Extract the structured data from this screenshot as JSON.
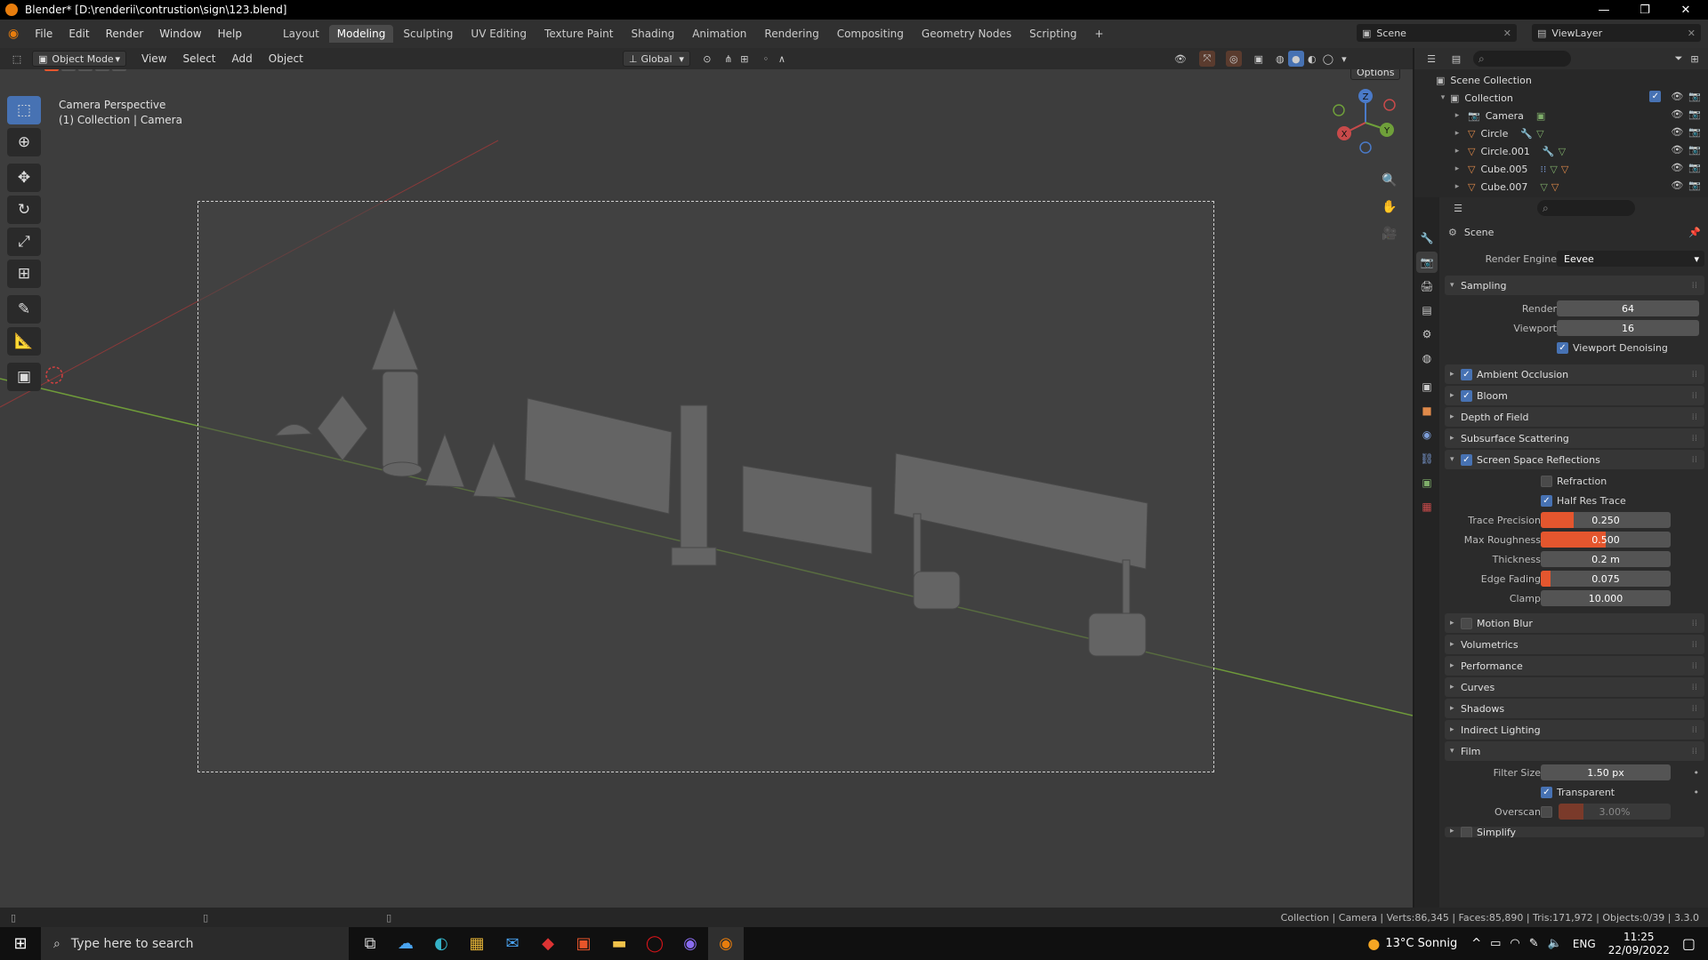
{
  "window": {
    "title": "Blender* [D:\\renderii\\contrustion\\sign\\123.blend]",
    "minimize": "—",
    "restore": "❐",
    "close": "✕"
  },
  "menu": {
    "items": [
      "File",
      "Edit",
      "Render",
      "Window",
      "Help"
    ]
  },
  "workspaces": {
    "tabs": [
      "Layout",
      "Modeling",
      "Sculpting",
      "UV Editing",
      "Texture Paint",
      "Shading",
      "Animation",
      "Rendering",
      "Compositing",
      "Geometry Nodes",
      "Scripting"
    ],
    "active": "Modeling",
    "add": "+"
  },
  "top_right": {
    "scene": "Scene",
    "view_layer": "ViewLayer"
  },
  "viewport_header": {
    "mode": "Object Mode",
    "menus": [
      "View",
      "Select",
      "Add",
      "Object"
    ],
    "orientation": "Global",
    "options": "Options"
  },
  "viewport": {
    "line1": "Camera Perspective",
    "line2": "(1) Collection | Camera"
  },
  "gizmo": {
    "x": "X",
    "y": "Y",
    "z": "Z"
  },
  "outliner": {
    "root": "Scene Collection",
    "collection": "Collection",
    "objects": [
      {
        "name": "Camera",
        "icon": "camera-icon"
      },
      {
        "name": "Circle",
        "icon": "mesh-icon"
      },
      {
        "name": "Circle.001",
        "icon": "mesh-icon"
      },
      {
        "name": "Cube.005",
        "icon": "mesh-icon"
      },
      {
        "name": "Cube.007",
        "icon": "mesh-icon"
      }
    ]
  },
  "properties": {
    "context": "Scene",
    "render_engine_label": "Render Engine",
    "render_engine": "Eevee",
    "sampling": {
      "title": "Sampling",
      "render_label": "Render",
      "render": "64",
      "viewport_label": "Viewport",
      "viewport": "16",
      "denoise": "Viewport Denoising"
    },
    "sections_a": [
      {
        "label": "Ambient Occlusion",
        "checkbox": true,
        "checked": true
      },
      {
        "label": "Bloom",
        "checkbox": true,
        "checked": true
      },
      {
        "label": "Depth of Field",
        "checkbox": false
      },
      {
        "label": "Subsurface Scattering",
        "checkbox": false
      }
    ],
    "ssr": {
      "title": "Screen Space Reflections",
      "refraction": "Refraction",
      "half_res": "Half Res Trace",
      "trace_precision_label": "Trace Precision",
      "trace_precision": "0.250",
      "trace_precision_frac": 0.25,
      "max_roughness_label": "Max Roughness",
      "max_roughness": "0.500",
      "max_roughness_frac": 0.5,
      "thickness_label": "Thickness",
      "thickness": "0.2 m",
      "edge_fading_label": "Edge Fading",
      "edge_fading": "0.075",
      "edge_fading_frac": 0.075,
      "clamp_label": "Clamp",
      "clamp": "10.000"
    },
    "sections_b": [
      {
        "label": "Motion Blur",
        "checkbox": true,
        "checked": false
      },
      {
        "label": "Volumetrics",
        "checkbox": false
      },
      {
        "label": "Performance",
        "checkbox": false
      },
      {
        "label": "Curves",
        "checkbox": false
      },
      {
        "label": "Shadows",
        "checkbox": false
      },
      {
        "label": "Indirect Lighting",
        "checkbox": false
      }
    ],
    "film": {
      "title": "Film",
      "filter_size_label": "Filter Size",
      "filter_size": "1.50 px",
      "transparent": "Transparent",
      "overscan_label": "Overscan",
      "overscan": "3.00%"
    },
    "simplify": "Simplify"
  },
  "status": {
    "text": "Collection | Camera | Verts:86,345 | Faces:85,890 | Tris:171,972 | Objects:0/39 | 3.3.0"
  },
  "taskbar": {
    "search_placeholder": "Type here to search",
    "weather": "13°C  Sonnig",
    "lang": "ENG",
    "time": "11:25",
    "date": "22/09/2022"
  },
  "colors": {
    "accent_blue": "#4772b3",
    "slider_orange": "#e4562e",
    "active_tool": "#4772b3"
  }
}
